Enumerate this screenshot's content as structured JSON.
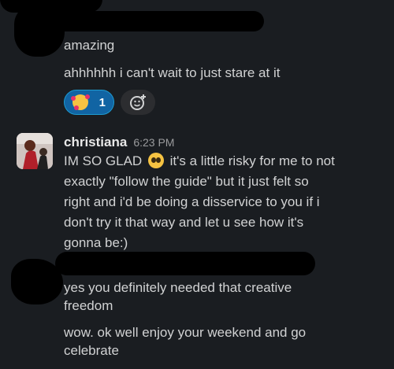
{
  "top_group": {
    "messages": [
      "amazing",
      "ahhhhhh i can't wait to just stare at it"
    ],
    "reactions": [
      {
        "icon": "smiling-face-with-hearts-icon",
        "count": "1",
        "active": true
      },
      {
        "icon": "add-reaction-icon"
      }
    ]
  },
  "christiana": {
    "author": "christiana",
    "time": "6:23 PM",
    "lines": [
      {
        "before": "IM SO GLAD",
        "emoji": "pleading-face-icon",
        "after": "it's a little risky for me to not"
      },
      "exactly \"follow the guide\" but it just felt so",
      "right and i'd be doing a disservice to you if i",
      "don't try it that way and let u see how it's",
      "gonna be:)"
    ]
  },
  "bottom_group": {
    "messages": [
      "yes you definitely needed that creative",
      "freedom",
      "wow. ok well enjoy your weekend and go",
      "celebrate"
    ]
  },
  "colors": {
    "background": "#1a1d21",
    "reaction_active": "#1164a3",
    "text": "#d1d2d3"
  }
}
